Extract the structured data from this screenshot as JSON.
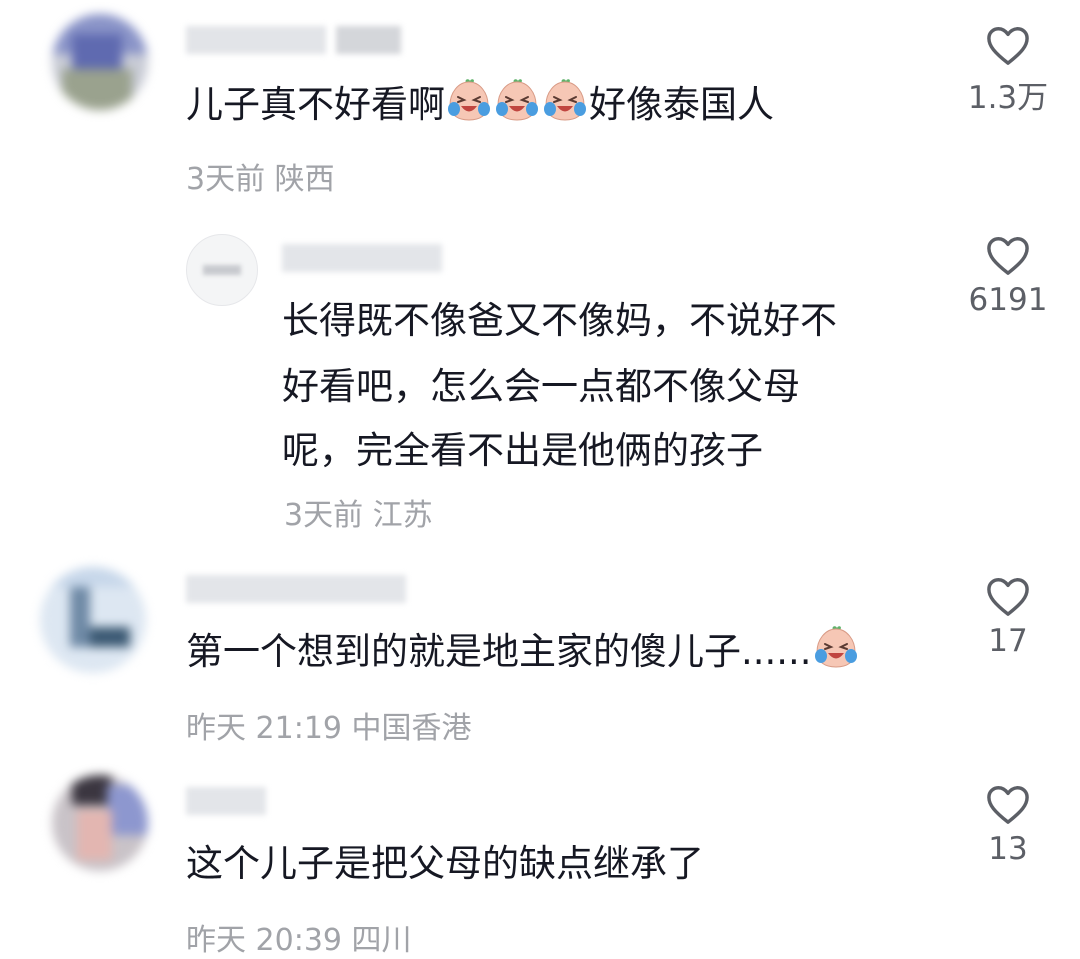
{
  "comments": [
    {
      "text_before": "儿子真不好看啊",
      "emoji_count": 3,
      "text_after": "好像泰国人",
      "meta": "3天前 陕西",
      "likes": "1.3万",
      "reply": {
        "lines": [
          "长得既不像爸又不像妈，不说好不",
          "好看吧，怎么会一点都不像父母",
          "呢，完全看不出是他俩的孩子"
        ],
        "meta": "3天前 江苏",
        "likes": "6191"
      }
    },
    {
      "text": "第一个想到的就是地主家的傻儿子......",
      "meta": "昨天 21:19 中国香港",
      "likes": "17"
    },
    {
      "text": "这个儿子是把父母的缺点继承了",
      "meta": "昨天 20:39 四川",
      "likes": "13"
    }
  ],
  "icons": {
    "like": "heart-outline-icon",
    "emoji": "crying-laughing-emoji-icon"
  },
  "colors": {
    "text": "#161823",
    "meta": "#a1a3a8",
    "count": "#5c5f66"
  }
}
